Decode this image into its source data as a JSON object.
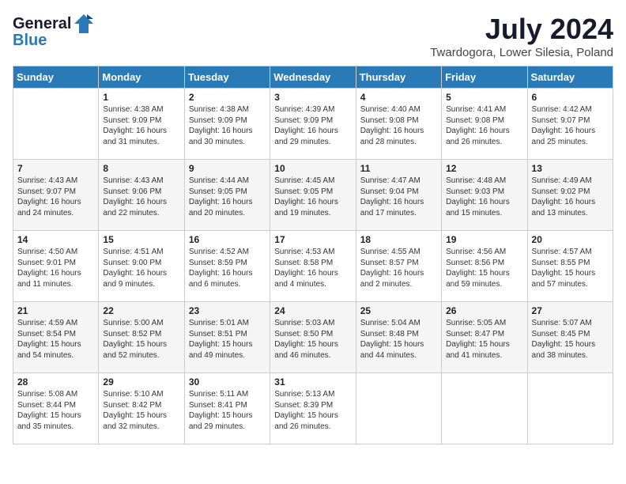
{
  "header": {
    "logo_general": "General",
    "logo_blue": "Blue",
    "month": "July 2024",
    "location": "Twardogora, Lower Silesia, Poland"
  },
  "days_of_week": [
    "Sunday",
    "Monday",
    "Tuesday",
    "Wednesday",
    "Thursday",
    "Friday",
    "Saturday"
  ],
  "weeks": [
    [
      {
        "day": "",
        "info": ""
      },
      {
        "day": "1",
        "info": "Sunrise: 4:38 AM\nSunset: 9:09 PM\nDaylight: 16 hours\nand 31 minutes."
      },
      {
        "day": "2",
        "info": "Sunrise: 4:38 AM\nSunset: 9:09 PM\nDaylight: 16 hours\nand 30 minutes."
      },
      {
        "day": "3",
        "info": "Sunrise: 4:39 AM\nSunset: 9:09 PM\nDaylight: 16 hours\nand 29 minutes."
      },
      {
        "day": "4",
        "info": "Sunrise: 4:40 AM\nSunset: 9:08 PM\nDaylight: 16 hours\nand 28 minutes."
      },
      {
        "day": "5",
        "info": "Sunrise: 4:41 AM\nSunset: 9:08 PM\nDaylight: 16 hours\nand 26 minutes."
      },
      {
        "day": "6",
        "info": "Sunrise: 4:42 AM\nSunset: 9:07 PM\nDaylight: 16 hours\nand 25 minutes."
      }
    ],
    [
      {
        "day": "7",
        "info": "Sunrise: 4:43 AM\nSunset: 9:07 PM\nDaylight: 16 hours\nand 24 minutes."
      },
      {
        "day": "8",
        "info": "Sunrise: 4:43 AM\nSunset: 9:06 PM\nDaylight: 16 hours\nand 22 minutes."
      },
      {
        "day": "9",
        "info": "Sunrise: 4:44 AM\nSunset: 9:05 PM\nDaylight: 16 hours\nand 20 minutes."
      },
      {
        "day": "10",
        "info": "Sunrise: 4:45 AM\nSunset: 9:05 PM\nDaylight: 16 hours\nand 19 minutes."
      },
      {
        "day": "11",
        "info": "Sunrise: 4:47 AM\nSunset: 9:04 PM\nDaylight: 16 hours\nand 17 minutes."
      },
      {
        "day": "12",
        "info": "Sunrise: 4:48 AM\nSunset: 9:03 PM\nDaylight: 16 hours\nand 15 minutes."
      },
      {
        "day": "13",
        "info": "Sunrise: 4:49 AM\nSunset: 9:02 PM\nDaylight: 16 hours\nand 13 minutes."
      }
    ],
    [
      {
        "day": "14",
        "info": "Sunrise: 4:50 AM\nSunset: 9:01 PM\nDaylight: 16 hours\nand 11 minutes."
      },
      {
        "day": "15",
        "info": "Sunrise: 4:51 AM\nSunset: 9:00 PM\nDaylight: 16 hours\nand 9 minutes."
      },
      {
        "day": "16",
        "info": "Sunrise: 4:52 AM\nSunset: 8:59 PM\nDaylight: 16 hours\nand 6 minutes."
      },
      {
        "day": "17",
        "info": "Sunrise: 4:53 AM\nSunset: 8:58 PM\nDaylight: 16 hours\nand 4 minutes."
      },
      {
        "day": "18",
        "info": "Sunrise: 4:55 AM\nSunset: 8:57 PM\nDaylight: 16 hours\nand 2 minutes."
      },
      {
        "day": "19",
        "info": "Sunrise: 4:56 AM\nSunset: 8:56 PM\nDaylight: 15 hours\nand 59 minutes."
      },
      {
        "day": "20",
        "info": "Sunrise: 4:57 AM\nSunset: 8:55 PM\nDaylight: 15 hours\nand 57 minutes."
      }
    ],
    [
      {
        "day": "21",
        "info": "Sunrise: 4:59 AM\nSunset: 8:54 PM\nDaylight: 15 hours\nand 54 minutes."
      },
      {
        "day": "22",
        "info": "Sunrise: 5:00 AM\nSunset: 8:52 PM\nDaylight: 15 hours\nand 52 minutes."
      },
      {
        "day": "23",
        "info": "Sunrise: 5:01 AM\nSunset: 8:51 PM\nDaylight: 15 hours\nand 49 minutes."
      },
      {
        "day": "24",
        "info": "Sunrise: 5:03 AM\nSunset: 8:50 PM\nDaylight: 15 hours\nand 46 minutes."
      },
      {
        "day": "25",
        "info": "Sunrise: 5:04 AM\nSunset: 8:48 PM\nDaylight: 15 hours\nand 44 minutes."
      },
      {
        "day": "26",
        "info": "Sunrise: 5:05 AM\nSunset: 8:47 PM\nDaylight: 15 hours\nand 41 minutes."
      },
      {
        "day": "27",
        "info": "Sunrise: 5:07 AM\nSunset: 8:45 PM\nDaylight: 15 hours\nand 38 minutes."
      }
    ],
    [
      {
        "day": "28",
        "info": "Sunrise: 5:08 AM\nSunset: 8:44 PM\nDaylight: 15 hours\nand 35 minutes."
      },
      {
        "day": "29",
        "info": "Sunrise: 5:10 AM\nSunset: 8:42 PM\nDaylight: 15 hours\nand 32 minutes."
      },
      {
        "day": "30",
        "info": "Sunrise: 5:11 AM\nSunset: 8:41 PM\nDaylight: 15 hours\nand 29 minutes."
      },
      {
        "day": "31",
        "info": "Sunrise: 5:13 AM\nSunset: 8:39 PM\nDaylight: 15 hours\nand 26 minutes."
      },
      {
        "day": "",
        "info": ""
      },
      {
        "day": "",
        "info": ""
      },
      {
        "day": "",
        "info": ""
      }
    ]
  ]
}
